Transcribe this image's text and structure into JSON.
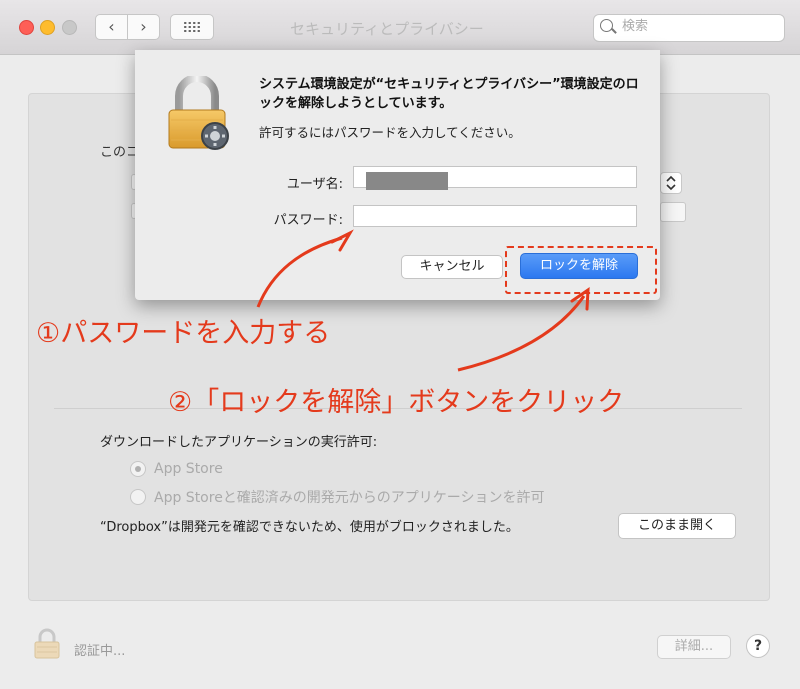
{
  "window": {
    "title": "セキュリティとプライバシー",
    "nav_back": "‹",
    "nav_forward": "›"
  },
  "search": {
    "placeholder": "検索"
  },
  "background": {
    "partial_label": "このコ",
    "section_label": "ダウンロードしたアプリケーションの実行許可:",
    "radio_app_store": "App Store",
    "radio_identified": "App Storeと確認済みの開発元からのアプリケーションを許可",
    "dropbox_message": "“Dropbox”は開発元を確認できないため、使用がブロックされました。",
    "open_anyway": "このまま開く",
    "status": "認証中...",
    "details": "詳細...",
    "help": "?"
  },
  "dialog": {
    "title": "システム環境設定が“セキュリティとプライバシー”環境設定のロックを解除しようとしています。",
    "subtitle": "許可するにはパスワードを入力してください。",
    "username_label": "ユーザ名:",
    "password_label": "パスワード:",
    "password_value": "",
    "cancel": "キャンセル",
    "unlock": "ロックを解除"
  },
  "annotations": {
    "step1": "①パスワードを入力する",
    "step2": "②「ロックを解除」ボタンをクリック"
  },
  "colors": {
    "annotation": "#e43a1c",
    "primary_button": "#2b78f0",
    "lock_gold": "#f0b040"
  }
}
